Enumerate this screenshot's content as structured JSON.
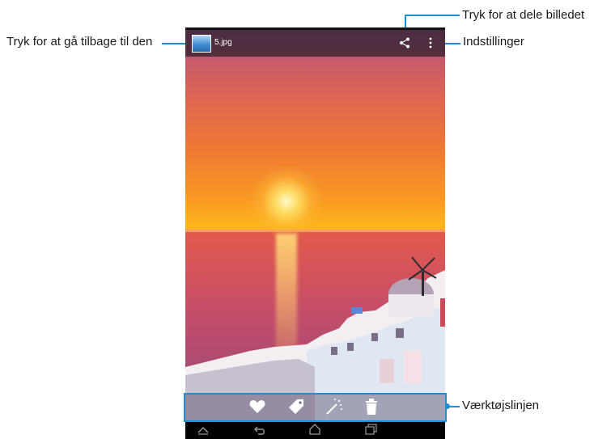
{
  "callouts": {
    "back": "Tryk for at gå tilbage til den",
    "share": "Tryk for at dele billedet",
    "settings": "Indstillinger",
    "toolbar": "Værktøjslinjen"
  },
  "actionbar": {
    "filename": "5.jpg"
  },
  "icons": {
    "share": "share-icon",
    "overflow": "overflow-menu-icon",
    "favorite": "heart-icon",
    "tag": "tag-icon",
    "edit": "magic-wand-icon",
    "delete": "trash-icon",
    "nav_back": "back-icon",
    "nav_home": "home-icon",
    "nav_recent": "recent-apps-icon"
  },
  "colors": {
    "callout_line": "#1a8fd6",
    "actionbar": "#281e2d",
    "navbar": "#000000"
  }
}
